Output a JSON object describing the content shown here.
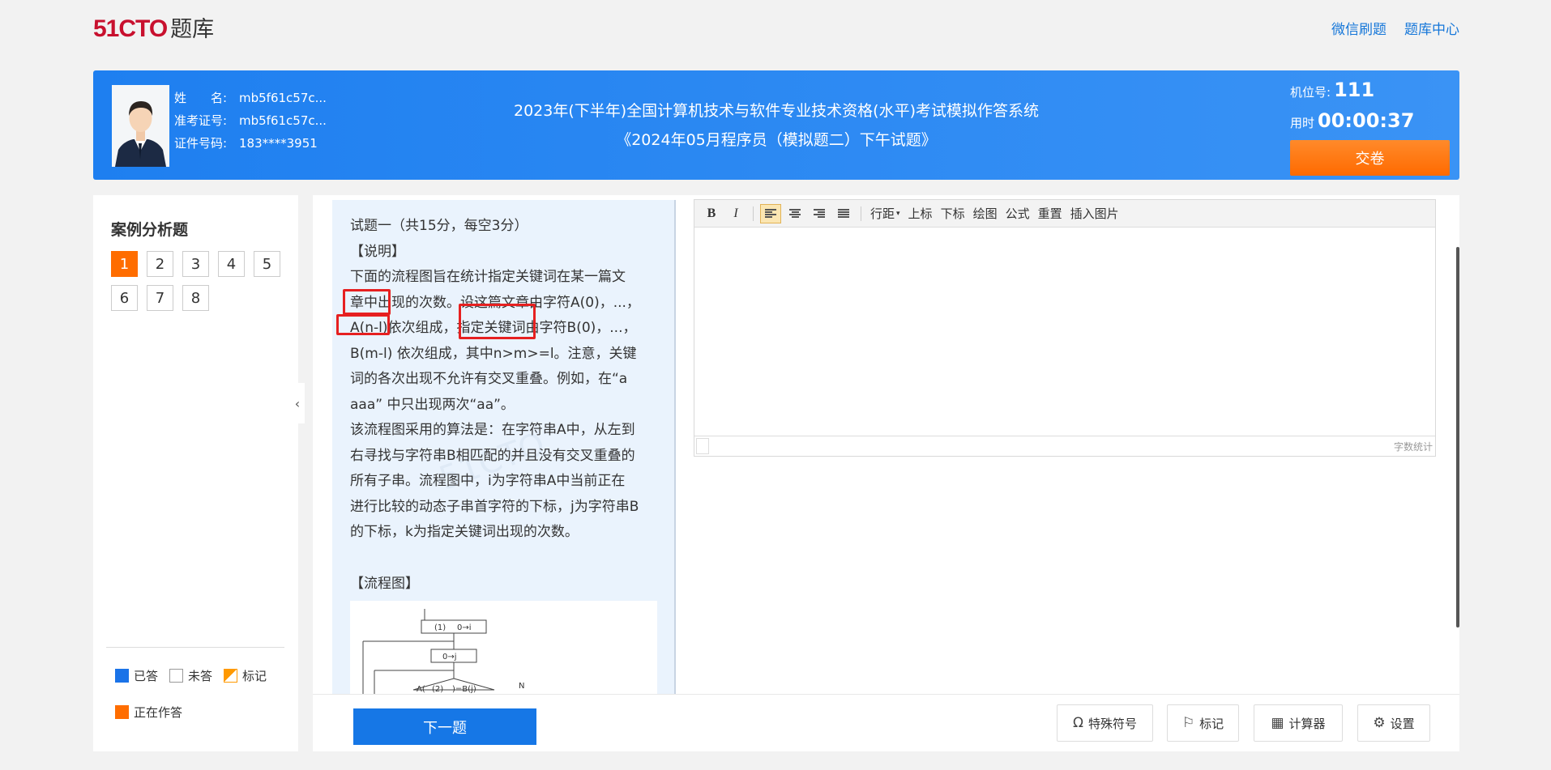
{
  "logo": {
    "brand": "51CTO",
    "sub": "题库"
  },
  "top_links": [
    "微信刷题",
    "题库中心"
  ],
  "candidate": {
    "name_label": "姓　　名:",
    "name": "mb5f61c57c...",
    "ticket_label": "准考证号:",
    "ticket": "mb5f61c57c...",
    "id_label": "证件号码:",
    "id": "183****3951"
  },
  "exam": {
    "title_line1": "2023年(下半年)全国计算机技术与软件专业技术资格(水平)考试模拟作答系统",
    "title_line2": "《2024年05月程序员（模拟题二）下午试题》"
  },
  "seat": {
    "label": "机位号:",
    "value": "111"
  },
  "timer": {
    "label": "用时",
    "value": "00:00:37"
  },
  "submit_label": "交卷",
  "sidebar": {
    "section_title": "案例分析题",
    "questions": [
      "1",
      "2",
      "3",
      "4",
      "5",
      "6",
      "7",
      "8"
    ],
    "active_question": "1",
    "legend": {
      "answered": "已答",
      "unanswered": "未答",
      "marked": "标记",
      "current": "正在作答"
    }
  },
  "question": {
    "header": "试题一（共15分，每空3分）",
    "section_desc": "【说明】",
    "lines": [
      "下面的流程图旨在统计指定关键词在某一篇文",
      "章中出现的次数。设这篇文章由字符A(0)，...，",
      "A(n-l)依次组成，指定关键词由字符B(0)，...，",
      "B(m-l) 依次组成，其中n>m>=l。注意，关键",
      "词的各次出现不允许有交叉重叠。例如，在“a",
      "aaa” 中只出现两次“aa”。",
      "该流程图采用的算法是：在字符串A中，从左到",
      "右寻找与字符串B相匹配的并且没有交叉重叠的",
      "所有子串。流程图中，i为字符串A中当前正在",
      "进行比较的动态子串首字符的下标，j为字符串B",
      "的下标，k为指定关键词出现的次数。"
    ],
    "flow_title": "【流程图】",
    "flow_labels": [
      "(1)",
      "0→i",
      "0→j",
      "A(",
      "(2)",
      ")=B(j)",
      "N"
    ]
  },
  "editor": {
    "toolbar": [
      "行距",
      "上标",
      "下标",
      "绘图",
      "公式",
      "重置",
      "插入图片"
    ],
    "word_count": "字数统计"
  },
  "bottom": {
    "next": "下一题",
    "special_chars": "特殊符号",
    "mark": "标记",
    "calculator": "计算器",
    "settings": "设置"
  }
}
